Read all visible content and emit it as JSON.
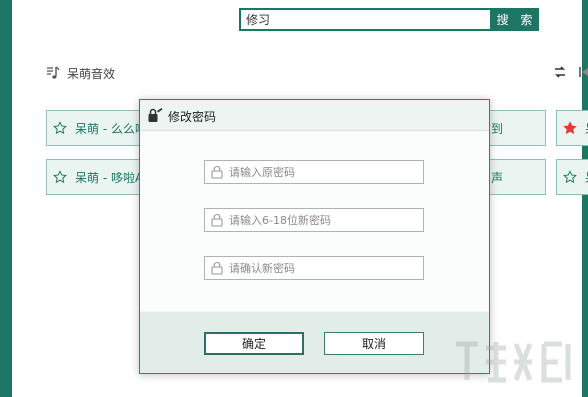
{
  "search": {
    "value": "修习",
    "button_label": "搜 索"
  },
  "section": {
    "title": "呆萌音效"
  },
  "tiles": [
    {
      "label": "呆萌 - 么么哒",
      "starred": false
    },
    {
      "label": "到",
      "starred": false
    },
    {
      "label": "呆",
      "starred": true
    },
    {
      "label": "呆萌 - 哆啦A",
      "starred": false
    },
    {
      "label": "声",
      "starred": false
    },
    {
      "label": "呆",
      "starred": false
    }
  ],
  "dialog": {
    "title": "修改密码",
    "fields": {
      "old_placeholder": "请输入原密码",
      "new_placeholder": "请输入6-18位新密码",
      "confirm_placeholder": "请确认新密码"
    },
    "ok_label": "确定",
    "cancel_label": "取消"
  },
  "colors": {
    "accent": "#1d7564",
    "tile_bg": "#eaf4f1",
    "tile_border": "#8cc1b4",
    "star_active": "#e53935"
  },
  "icons": {
    "section": "music-note-icon",
    "shuffle": "shuffle-icon",
    "previous": "skip-previous-icon",
    "dialog": "lock-edit-icon",
    "field": "padlock-icon",
    "star": "star-icon"
  }
}
